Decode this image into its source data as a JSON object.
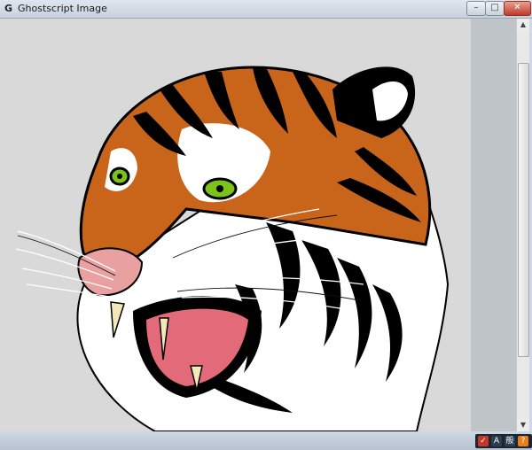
{
  "window": {
    "title": "Ghostscript Image",
    "app_icon_glyph": "G",
    "buttons": {
      "minimize": "–",
      "maximize": "□",
      "close": "✕"
    }
  },
  "scrollbar": {
    "up": "▲",
    "down": "▼"
  },
  "tray": {
    "icons": [
      {
        "name": "check-icon",
        "glyph": "✓",
        "color": "#c0392b"
      },
      {
        "name": "ime-icon",
        "glyph": "A",
        "color": "#2c3e50"
      },
      {
        "name": "input-mode-icon",
        "glyph": "般",
        "color": "#2c3e50"
      },
      {
        "name": "help-icon",
        "glyph": "?",
        "color": "#e67e22"
      }
    ]
  },
  "colors": {
    "fur_orange": "#c8651b",
    "eye_green": "#7bc21a",
    "mouth_pink": "#e36a79",
    "nose_pink": "#e8a0a0"
  }
}
